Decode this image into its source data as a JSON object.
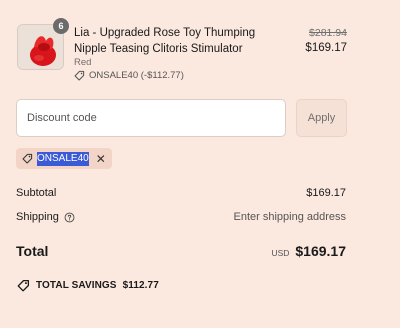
{
  "product": {
    "quantity": "6",
    "title": "Lia - Upgraded Rose Toy Thumping Nipple Teasing Clitoris Stimulator",
    "variant": "Red",
    "discount_line": "ONSALE40 (-$112.77)",
    "price_original": "$281.94",
    "price_current": "$169.17",
    "image_desc": "red rose toy"
  },
  "discount": {
    "placeholder": "Discount code",
    "apply_label": "Apply",
    "applied_code": "ONSALE40"
  },
  "summary": {
    "subtotal_label": "Subtotal",
    "subtotal_value": "$169.17",
    "shipping_label": "Shipping",
    "shipping_value": "Enter shipping address",
    "total_label": "Total",
    "currency": "USD",
    "total_value": "$169.17",
    "savings_label": "TOTAL SAVINGS",
    "savings_value": "$112.77"
  },
  "colors": {
    "background": "#fbe8df",
    "selection": "#3b5bd6",
    "product_red": "#e0201e"
  }
}
